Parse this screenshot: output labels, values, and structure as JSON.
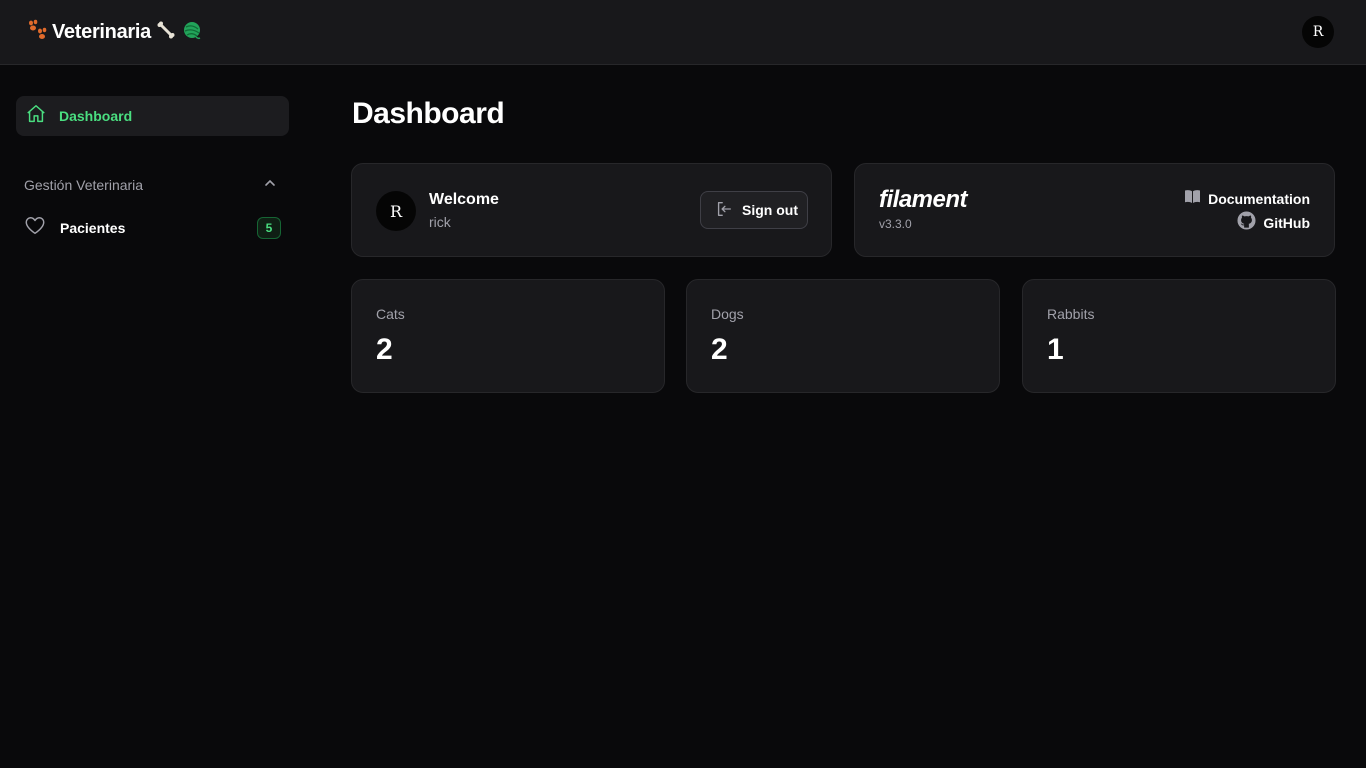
{
  "app": {
    "brand_title": "Veterinaria",
    "user_initial": "R"
  },
  "sidebar": {
    "dashboard_label": "Dashboard",
    "group_label": "Gestión Veterinaria",
    "items": [
      {
        "label": "Pacientes",
        "badge": "5"
      }
    ]
  },
  "main": {
    "page_title": "Dashboard",
    "welcome": {
      "avatar_initial": "R",
      "title": "Welcome",
      "username": "rick",
      "sign_out_label": "Sign out"
    },
    "filament": {
      "logo_text": "filament",
      "version": "v3.3.0",
      "documentation_label": "Documentation",
      "github_label": "GitHub"
    },
    "stats": [
      {
        "label": "Cats",
        "value": "2"
      },
      {
        "label": "Dogs",
        "value": "2"
      },
      {
        "label": "Rabbits",
        "value": "1"
      }
    ]
  },
  "colors": {
    "accent": "#4ade80",
    "background": "#09090b",
    "surface": "#18181b",
    "muted_text": "#a1a1aa"
  },
  "icons": {
    "brand_left": "paw-prints-icon",
    "brand_right_1": "bone-icon",
    "brand_right_2": "yarn-ball-icon",
    "dashboard": "home-icon",
    "group_toggle": "chevron-up-icon",
    "pacientes": "heart-icon",
    "sign_out": "logout-icon",
    "documentation": "book-icon",
    "github": "github-icon"
  }
}
